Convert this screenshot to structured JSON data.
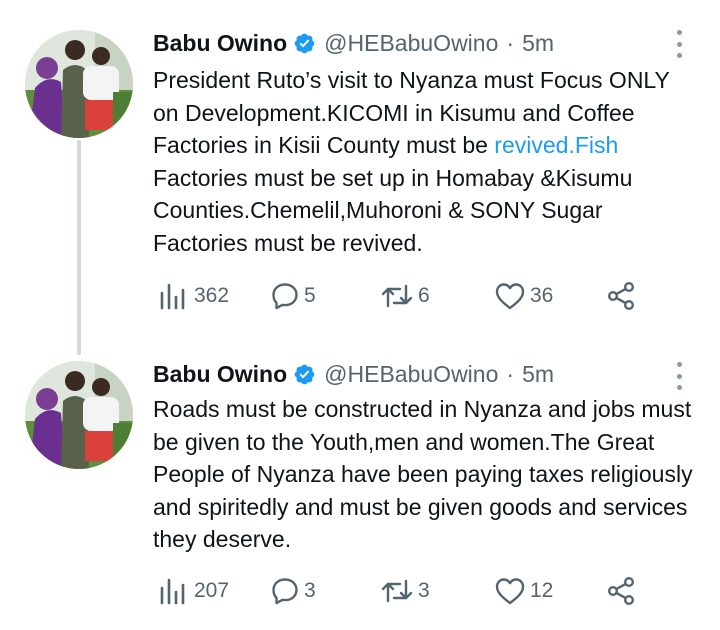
{
  "tweets": [
    {
      "author_name": "Babu Owino",
      "handle": "@HEBabuOwino",
      "separator": "·",
      "time": "5m",
      "text_before_link": "President Ruto’s visit to Nyanza must Focus ONLY on Development.KICOMI in Kisumu and Coffee Factories in Kisii County must be ",
      "link_text": "revived.Fish",
      "text_after_link": " Factories must be set up in Homabay &Kisumu Counties.Chemelil,Muhoroni & SONY Sugar Factories must be revived.",
      "views": "362",
      "replies": "5",
      "retweets": "6",
      "likes": "36"
    },
    {
      "author_name": "Babu Owino",
      "handle": "@HEBabuOwino",
      "separator": "·",
      "time": "5m",
      "text": "Roads must be constructed in Nyanza and jobs must be given to the Youth,men and women.The Great People of Nyanza have been paying taxes religiously and spiritedly and must be given goods and services they deserve.",
      "views": "207",
      "replies": "3",
      "retweets": "3",
      "likes": "12"
    }
  ],
  "icons": {
    "verified": "verified-badge-icon",
    "more": "more-options-icon",
    "views": "views-chart-icon",
    "reply": "reply-bubble-icon",
    "retweet": "retweet-icon",
    "like": "heart-icon",
    "share": "share-icon"
  },
  "colors": {
    "text": "#0f1419",
    "secondary": "#536471",
    "link": "#1d9bf0",
    "thread_line": "#cfd9de"
  }
}
